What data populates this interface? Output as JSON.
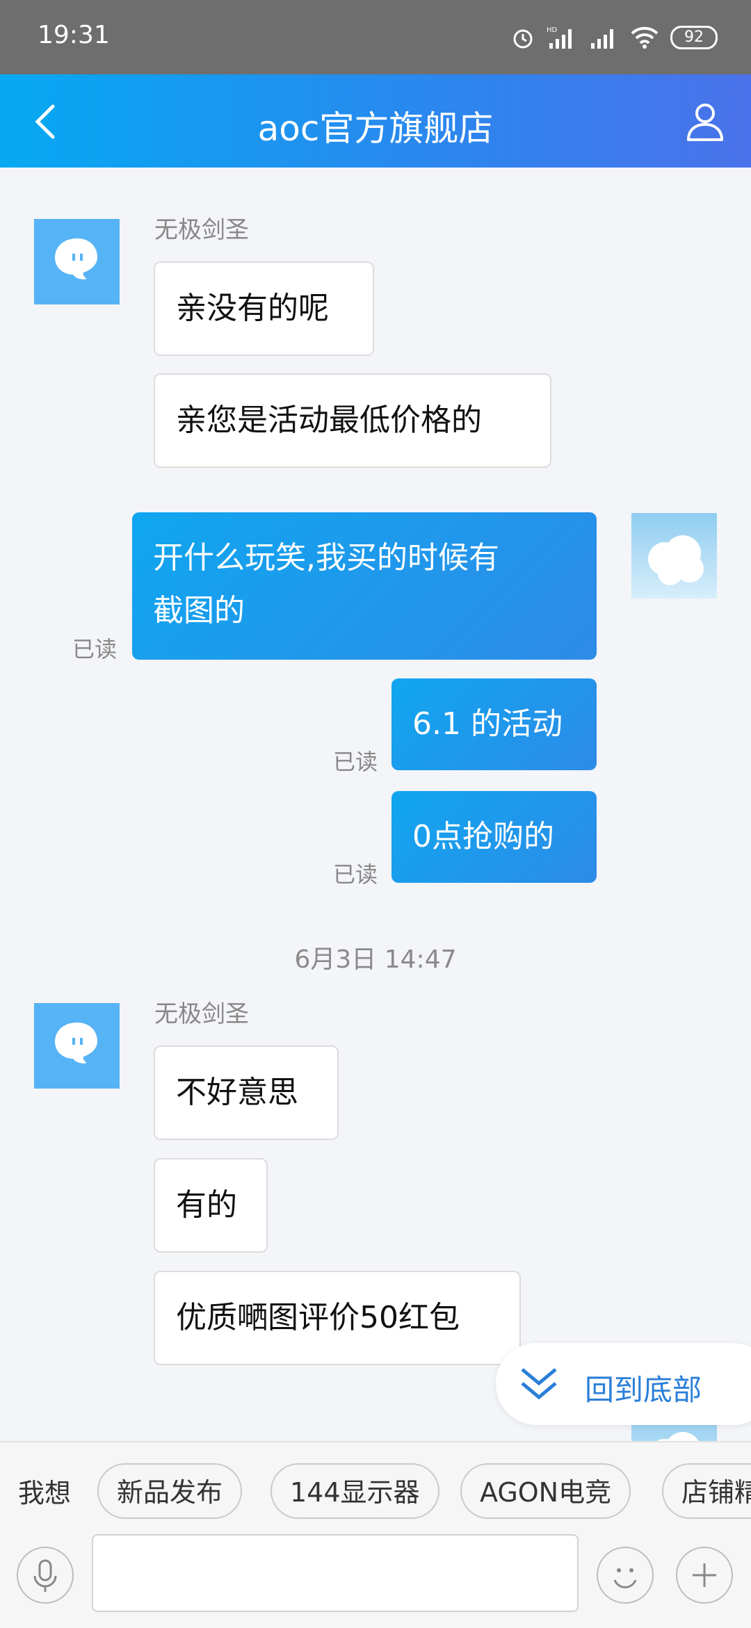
{
  "status_bar": {
    "time": "19:31",
    "battery": "92"
  },
  "header": {
    "title": "aoc官方旗舰店"
  },
  "messages": {
    "m1_sender": "无极剑圣",
    "m1_b1": "亲没有的呢",
    "m1_b2": "亲您是活动最低价格的",
    "m2_line1": "开什么玩笑,我买的时候有",
    "m2_line2": "截图的",
    "m3": "6.1 的活动",
    "m4": "0点抢购的",
    "read": "已读",
    "timestamp": "6月3日 14:47",
    "m5_sender": "无极剑圣",
    "m5_b1": "不好意思",
    "m5_b2": "有的",
    "m5_b3": "优质嗮图评价50红包"
  },
  "scroll_to_bottom": {
    "label": "回到底部"
  },
  "quick_replies": {
    "label": "我想",
    "chips": [
      "新品发布",
      "144显示器",
      "AGON电竞",
      "店铺精"
    ]
  },
  "colors": {
    "accent": "#1f96ec",
    "header_start": "#06a9f2",
    "header_end": "#4b72ea"
  }
}
